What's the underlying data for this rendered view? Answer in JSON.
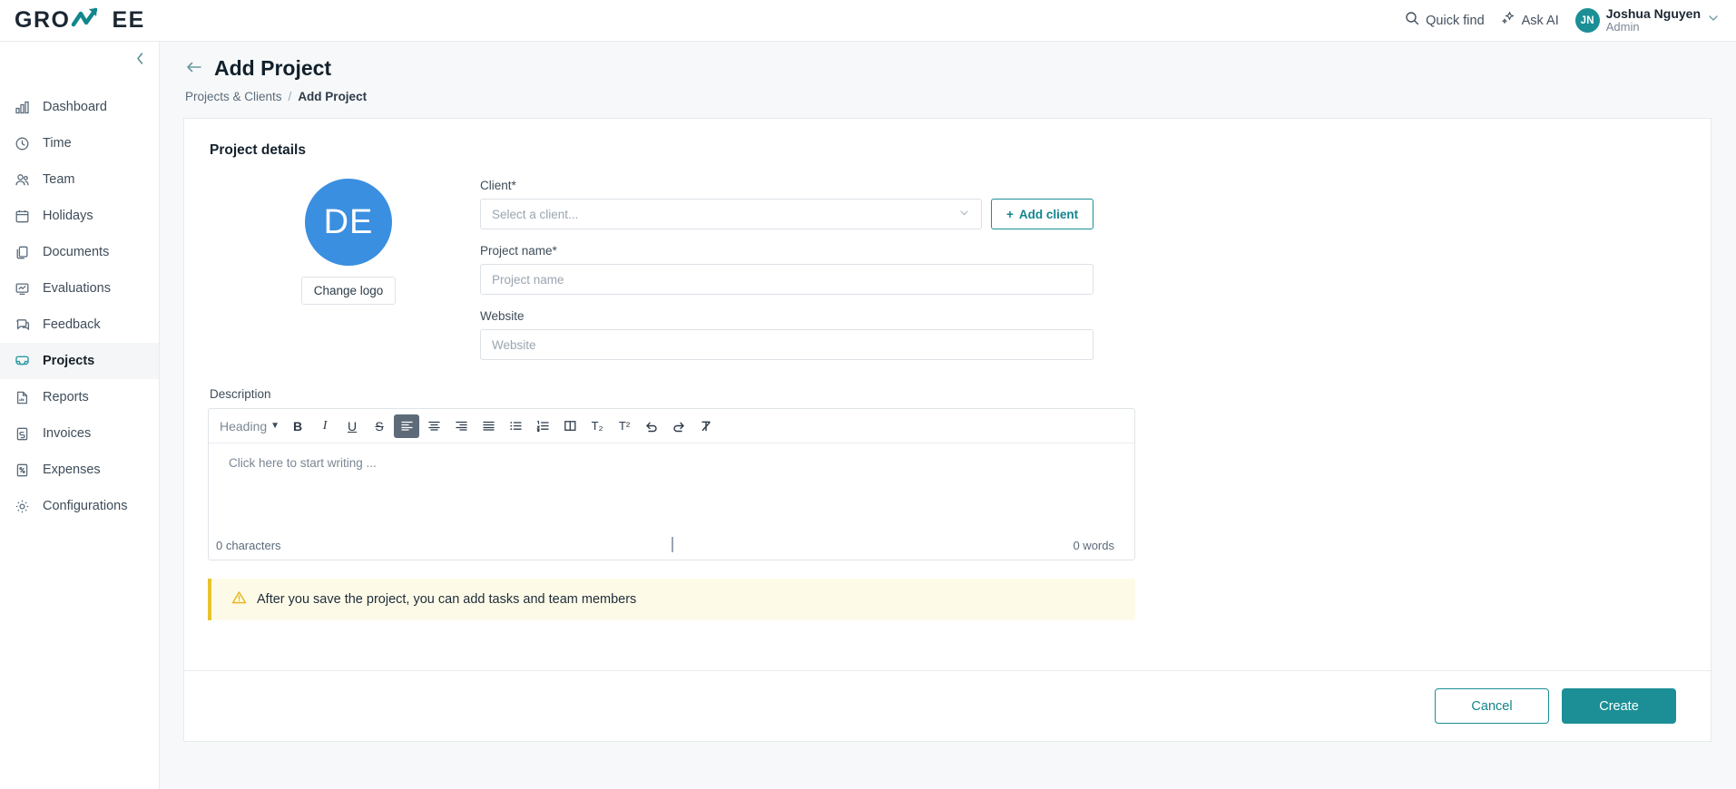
{
  "brand": {
    "logo_left": "GRO",
    "logo_right": "EE",
    "accent_color": "#1b8f95",
    "avatar_color": "#3b8fe0",
    "warning_color": "#e8c32e"
  },
  "topbar": {
    "quick_find": "Quick find",
    "ask_ai": "Ask AI",
    "avatar_initials": "JN",
    "user_name": "Joshua Nguyen",
    "user_role": "Admin"
  },
  "sidebar": {
    "items": [
      {
        "label": "Dashboard",
        "icon": "bar-chart-icon",
        "active": false
      },
      {
        "label": "Time",
        "icon": "clock-icon",
        "active": false
      },
      {
        "label": "Team",
        "icon": "people-icon",
        "active": false
      },
      {
        "label": "Holidays",
        "icon": "calendar-icon",
        "active": false
      },
      {
        "label": "Documents",
        "icon": "documents-icon",
        "active": false
      },
      {
        "label": "Evaluations",
        "icon": "evaluations-icon",
        "active": false
      },
      {
        "label": "Feedback",
        "icon": "chat-icon",
        "active": false
      },
      {
        "label": "Projects",
        "icon": "inbox-icon",
        "active": true
      },
      {
        "label": "Reports",
        "icon": "report-icon",
        "active": false
      },
      {
        "label": "Invoices",
        "icon": "invoice-icon",
        "active": false
      },
      {
        "label": "Expenses",
        "icon": "expense-icon",
        "active": false
      },
      {
        "label": "Configurations",
        "icon": "gear-icon",
        "active": false
      }
    ]
  },
  "page": {
    "title": "Add Project",
    "breadcrumb_parent": "Projects & Clients",
    "breadcrumb_sep": "/",
    "breadcrumb_current": "Add Project"
  },
  "form": {
    "section_title": "Project details",
    "logo_initials": "DE",
    "change_logo_label": "Change logo",
    "client_label": "Client*",
    "client_placeholder": "Select a client...",
    "client_value": "",
    "add_client_label": "Add client",
    "add_client_plus": "+",
    "project_name_label": "Project name*",
    "project_name_placeholder": "Project name",
    "project_name_value": "",
    "website_label": "Website",
    "website_placeholder": "Website",
    "website_value": "",
    "description_label": "Description"
  },
  "editor": {
    "heading_label": "Heading",
    "heading_caret": "▼",
    "placeholder": "Click here to start writing ...",
    "characters": "0 characters",
    "words": "0 words",
    "tools": [
      {
        "name": "bold-icon",
        "glyph": "B"
      },
      {
        "name": "italic-icon",
        "glyph": "I"
      },
      {
        "name": "underline-icon",
        "glyph": "U"
      },
      {
        "name": "strikethrough-icon",
        "glyph": "S"
      },
      {
        "name": "align-left-icon",
        "glyph": ""
      },
      {
        "name": "align-center-icon",
        "glyph": ""
      },
      {
        "name": "align-right-icon",
        "glyph": ""
      },
      {
        "name": "align-justify-icon",
        "glyph": ""
      },
      {
        "name": "bullet-list-icon",
        "glyph": ""
      },
      {
        "name": "numbered-list-icon",
        "glyph": ""
      },
      {
        "name": "columns-icon",
        "glyph": ""
      },
      {
        "name": "subscript-icon",
        "glyph": "T₂"
      },
      {
        "name": "superscript-icon",
        "glyph": "T²"
      },
      {
        "name": "undo-icon",
        "glyph": "↺"
      },
      {
        "name": "redo-icon",
        "glyph": "↻"
      },
      {
        "name": "clear-format-icon",
        "glyph": ""
      }
    ]
  },
  "notice": {
    "text": "After you save the project, you can add tasks and team members"
  },
  "footer": {
    "cancel_label": "Cancel",
    "create_label": "Create"
  }
}
